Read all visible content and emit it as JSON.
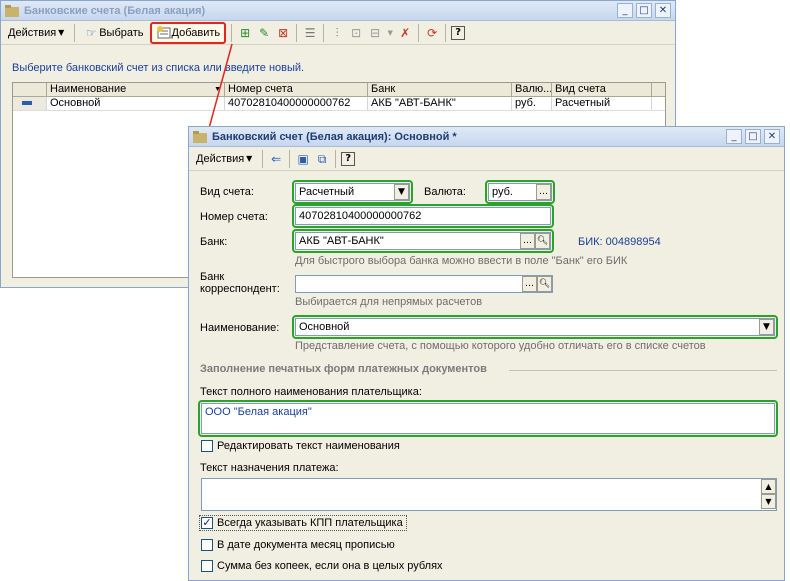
{
  "list_window": {
    "title": "Банковские счета (Белая акация)",
    "toolbar": {
      "actions_label": "Действия",
      "select_label": "Выбрать",
      "add_label": "Добавить"
    },
    "hint": "Выберите банковский счет из списка или введите новый.",
    "columns": [
      "Наименование",
      "Номер счета",
      "Банк",
      "Валю...",
      "Вид счета"
    ],
    "rows": [
      {
        "name": "Основной",
        "account": "40702810400000000762",
        "bank": "АКБ \"АВТ-БАНК\"",
        "currency": "руб.",
        "type": "Расчетный"
      }
    ]
  },
  "form_window": {
    "title": "Банковский счет (Белая акация): Основной *",
    "toolbar": {
      "actions_label": "Действия"
    },
    "fields": {
      "account_type_label": "Вид счета:",
      "account_type_value": "Расчетный",
      "currency_label": "Валюта:",
      "currency_value": "руб.",
      "account_number_label": "Номер счета:",
      "account_number_value": "40702810400000000762",
      "bank_label": "Банк:",
      "bank_value": "АКБ \"АВТ-БАНК\"",
      "bik_text": "БИК: 004898954",
      "bank_hint": "Для быстрого выбора банка можно ввести в поле \"Банк\" его БИК",
      "corr_bank_label_1": "Банк",
      "corr_bank_label_2": "корреспондент:",
      "corr_bank_value": "",
      "corr_bank_hint": "Выбирается для непрямых расчетов",
      "name_label": "Наименование:",
      "name_value": "Основной",
      "name_hint": "Представление счета, с помощью которого удобно отличать его в списке счетов"
    },
    "print_section": {
      "header": "Заполнение печатных форм платежных документов",
      "payer_full_name_label": "Текст полного наименования плательщика:",
      "payer_full_name_value": "ООО \"Белая акация\"",
      "edit_name_checkbox": "Редактировать текст наименования",
      "edit_name_checked": false,
      "payment_purpose_label": "Текст назначения платежа:",
      "payment_purpose_value": "",
      "kpp_checkbox": "Всегда указывать КПП плательщика",
      "kpp_checked": true,
      "month_words_checkbox": "В дате документа месяц прописью",
      "month_words_checked": false,
      "no_kopecks_checkbox": "Сумма без копеек, если она в целых рублях",
      "no_kopecks_checked": false
    }
  },
  "colors": {
    "highlight_red": "#e0261f",
    "highlight_green": "#2aa32a",
    "window_bg": "#f1efe2"
  }
}
